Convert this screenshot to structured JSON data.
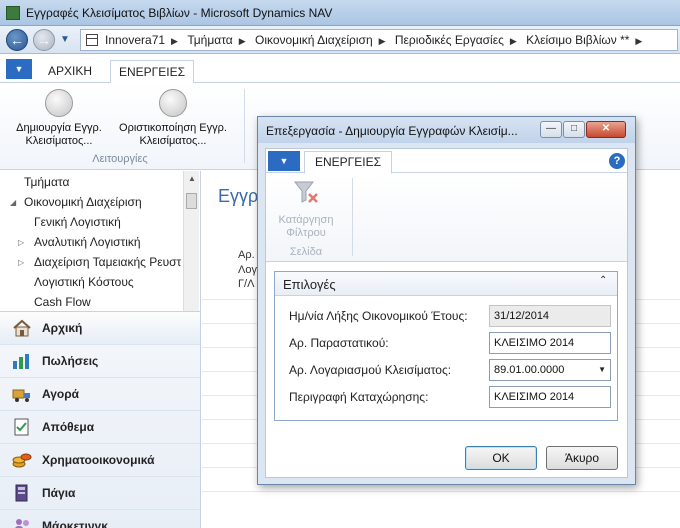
{
  "window": {
    "title": "Εγγραφές Κλεισίματος Βιβλίων - Microsoft Dynamics NAV"
  },
  "address": {
    "crumbs": [
      "Innovera71",
      "Τμήματα",
      "Οικονομική Διαχείριση",
      "Περιοδικές Εργασίες",
      "Κλείσιμο Βιβλίων **"
    ]
  },
  "ribbon": {
    "tabs": {
      "home": "ΑΡΧΙΚΗ",
      "actions": "ΕΝΕΡΓΕΙΕΣ"
    },
    "buttons": {
      "create_line1": "Δημιουργία Εγγρ.",
      "create_line2": "Κλεισίματος...",
      "post_line1": "Οριστικοποίηση Εγγρ.",
      "post_line2": "Κλεισίματος..."
    },
    "group_label": "Λειτουργίες"
  },
  "navpane": {
    "tree": [
      "Τμήματα",
      "Οικονομική Διαχείριση",
      "Γενική Λογιστική",
      "Αναλυτική Λογιστική",
      "Διαχείριση Ταμειακής Ρευστ",
      "Λογιστική Κόστους",
      "Cash Flow"
    ],
    "buttons": [
      "Αρχική",
      "Πωλήσεις",
      "Αγορά",
      "Απόθεμα",
      "Χρηματοοικονομικά",
      "Πάγια",
      "Μάρκετινγκ"
    ]
  },
  "main": {
    "title": "Εγγρ",
    "labels": [
      "Αρ.",
      "Λογ",
      "Γ/Λ"
    ]
  },
  "dialog": {
    "title": "Επεξεργασία - Δημιουργία Εγγραφών Κλεισίμ...",
    "ribbon_tab": "ΕΝΕΡΓΕΙΕΣ",
    "clear_filter_line1": "Κατάργηση",
    "clear_filter_line2": "Φίλτρου",
    "group_label": "Σελίδα",
    "fasttab_title": "Επιλογές",
    "fields": {
      "fiscal_year_end_label": "Ημ/νία Λήξης Οικονομικού Έτους:",
      "fiscal_year_end_value": "31/12/2014",
      "document_no_label": "Αρ. Παραστατικού:",
      "document_no_value": "ΚΛΕΙΣΙΜΟ 2014",
      "closing_account_label": "Αρ. Λογαριασμού Κλεισίματος:",
      "closing_account_value": "89.01.00.0000",
      "posting_description_label": "Περιγραφή Καταχώρησης:",
      "posting_description_value": "ΚΛΕΙΣΙΜΟ 2014"
    },
    "ok_label": "OK",
    "cancel_label": "Άκυρο"
  }
}
